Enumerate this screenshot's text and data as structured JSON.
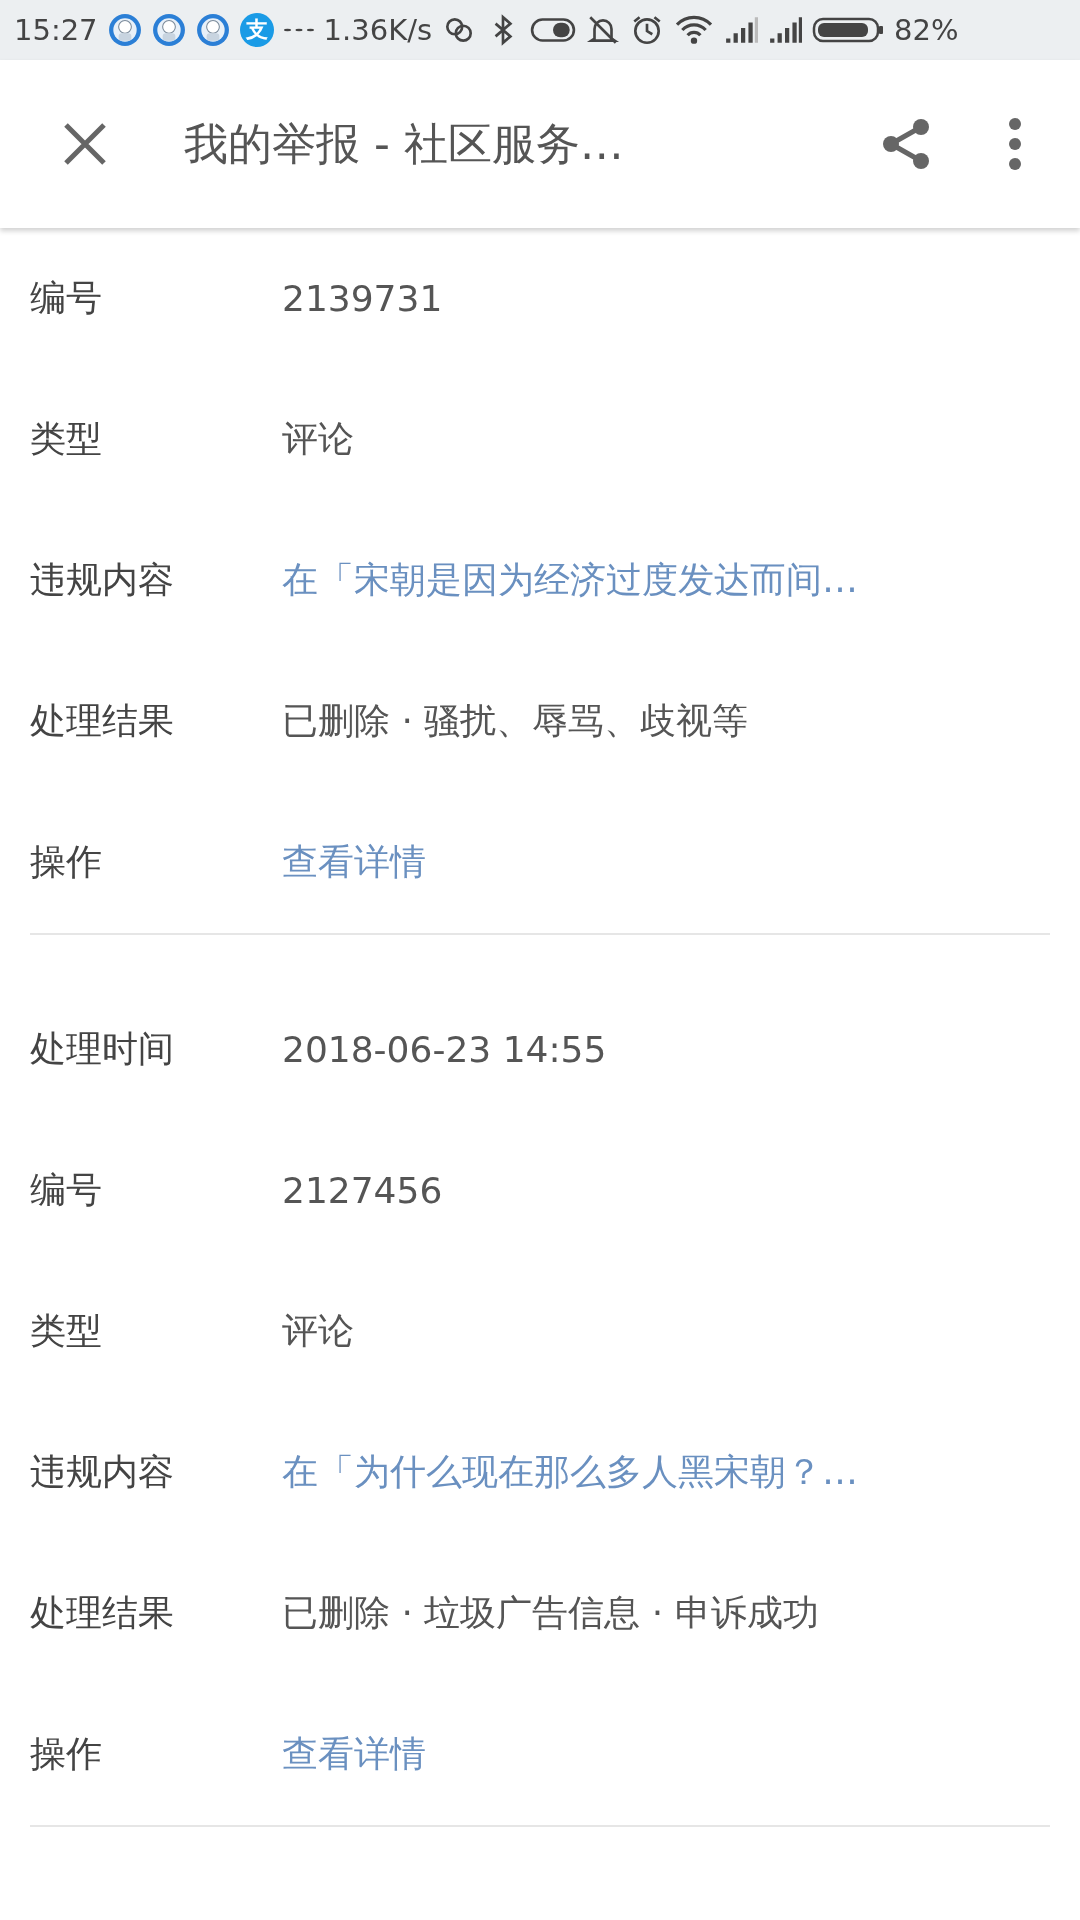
{
  "status_bar": {
    "time": "15:27",
    "app_glyph": "支",
    "net_speed": "1.36K/s",
    "battery": "82%"
  },
  "toolbar": {
    "title": "我的举报 - 社区服务…"
  },
  "records": [
    {
      "rows": [
        {
          "label": "编号",
          "value": "2139731",
          "kind": "text"
        },
        {
          "label": "类型",
          "value": "评论",
          "kind": "text"
        },
        {
          "label": "违规内容",
          "value": "在「宋朝是因为经济过度发达而间…",
          "kind": "link"
        },
        {
          "label": "处理结果",
          "value": "已删除 · 骚扰、辱骂、歧视等",
          "kind": "text"
        },
        {
          "label": "操作",
          "value": "查看详情",
          "kind": "link"
        }
      ]
    },
    {
      "rows": [
        {
          "label": "处理时间",
          "value": "2018-06-23 14:55",
          "kind": "text"
        },
        {
          "label": "编号",
          "value": "2127456",
          "kind": "text"
        },
        {
          "label": "类型",
          "value": "评论",
          "kind": "text"
        },
        {
          "label": "违规内容",
          "value": "在「为什么现在那么多人黑宋朝？…",
          "kind": "link"
        },
        {
          "label": "处理结果",
          "value": "已删除 · 垃圾广告信息 · 申诉成功",
          "kind": "text"
        },
        {
          "label": "操作",
          "value": "查看详情",
          "kind": "link"
        }
      ]
    }
  ]
}
